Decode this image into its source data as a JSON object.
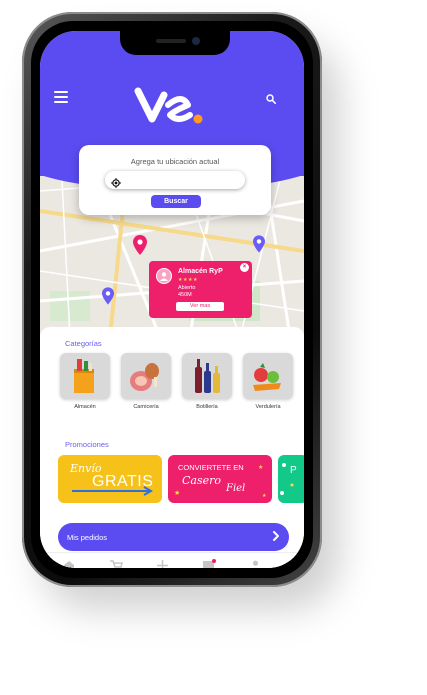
{
  "location": {
    "title": "Agrega tu ubicación actual",
    "search_label": "Buscar"
  },
  "store_popup": {
    "name": "Almacén RyP",
    "stars": "★★★★",
    "status": "Abierto",
    "distance": "450M",
    "cta": "Ver mas",
    "close": "×"
  },
  "categories": {
    "title": "Categorías",
    "items": [
      {
        "label": "Almacén"
      },
      {
        "label": "Carnicería"
      },
      {
        "label": "Botillería"
      },
      {
        "label": "Verdulería"
      }
    ]
  },
  "promotions": {
    "title": "Promociones",
    "promo1": {
      "line1": "Envío",
      "line2": "GRATIS"
    },
    "promo2": {
      "line1": "CONVIERTETE EN",
      "line2": "Casero",
      "line3": "Fiel"
    }
  },
  "orders_button": "Mis pedidos",
  "colors": {
    "brand": "#5b4cf2",
    "accent": "#ee1f6b",
    "logo_dot": "#ff9a1f"
  }
}
